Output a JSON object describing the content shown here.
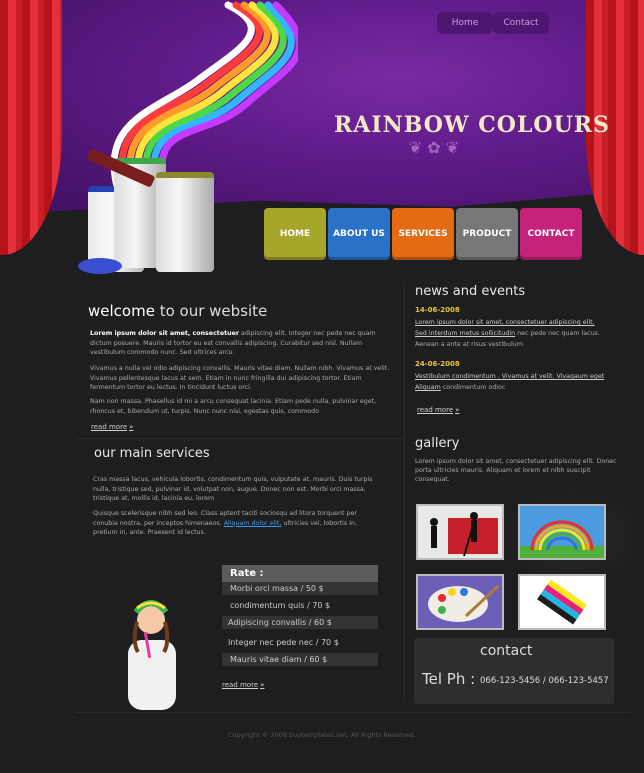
{
  "header": {
    "top_links": [
      "Home",
      "Contact"
    ],
    "brand": "RAINBOW COLOURS",
    "colors": {
      "purple": "#5c1a86",
      "curtain": "#d2232c"
    }
  },
  "nav": {
    "items": [
      {
        "label": "HOME",
        "color": "#a6a62a"
      },
      {
        "label": "ABOUT US",
        "color": "#2a72c8"
      },
      {
        "label": "SERVICES",
        "color": "#e46a14"
      },
      {
        "label": "PRODUCT",
        "color": "#777777"
      },
      {
        "label": "CONTACT",
        "color": "#c5237a"
      }
    ]
  },
  "welcome": {
    "title_strong": "welcome",
    "title_rest": " to our website",
    "p1_bold": "Lorem ipsum dolor sit amet, consectetuer",
    "p1_rest": " adipiscing elit. Integer nec pede nec quam dictum posuere. Mauris id tortor eu est convallis adipiscing. Curabitur sed nisl. Nullam vestibulum commodo nunc. Sed ultrices arcu.",
    "p2": "Vivamus a nulla vel odio adipiscing convallis. Mauris vitae diam. Nullam nibh. Vivamus at velit. Vivamus pellentesque lacus at sem. Etiam in nunc fringilla dui adipiscing tortor. Etiam fermentum tortor eu lectus. In tincidunt luctus orci.",
    "p3": "Nam non massa. Phasellus id mi a arcu consequat lacinia. Etiam pede nulla, pulvinar eget, rhoncus et, bibendum ut, turpis. Nunc nunc nisi, egestas quis, commodo",
    "read_more": "read more"
  },
  "services": {
    "title": "our main services",
    "p1": "Cras massa lacus, vehicula lobortis, condimentum quis, vulputate at, mauris. Duis turpis nulla, tristique sed, pulvinar id, volutpat non, augue. Donec non est. Morbi orci massa, tristique at, mollis id, lacinia eu, lorem",
    "p2_start": "Quisque scelerisque nibh sed leo. Class aptent taciti sociosqu ad litora torquent per conubia nostra, per inceptos himenaeos. ",
    "p2_link": "Aliquam dolor elit,",
    "p2_end": " ultricies vel, lobortis in, pretium in, ante. Praesent id lectus.",
    "read_more": "read more"
  },
  "rate": {
    "title": "Rate :",
    "rows": [
      {
        "label": "Morbi orci massa",
        "price": "50 $"
      },
      {
        "label": "condimentum quis",
        "price": "70 $"
      },
      {
        "label": "Adipiscing convallis",
        "price": "60  $"
      },
      {
        "label": "Integer nec pede nec",
        "price": "70 $"
      },
      {
        "label": "Mauris vitae diam",
        "price": "60  $"
      }
    ]
  },
  "news": {
    "title": "news and events",
    "items": [
      {
        "date": "14-06-2008",
        "link1": "Lorem ipsum dolor sit amet, consectetuer adipiscing elit.",
        "link2": "Sed interdum metus sollicitudin",
        "text2": " nec pede nec quam lacus.",
        "text3": "Aenean a ante at risus vestibulum"
      },
      {
        "date": "24-06-2008",
        "link1": "Vestibulum condimentum . Vivamus at velit. Vivagaum eget",
        "link2": "Aliquam",
        "text2": " condimentum odioc"
      }
    ],
    "read_more": "read more"
  },
  "gallery": {
    "title": "gallery",
    "text": "Lorem ipsum dolor sit amet, consectetuer adipiscing elit. Donec porta ultricies mauris. Aliquam et lorem et nibh suscipit consequat."
  },
  "contact": {
    "title": "contact",
    "tel_label": "Tel Ph :",
    "tel_numbers": "066-123-5456  /  066-123-5457"
  },
  "footer": {
    "copyright": "Copyright © 2008 buytemplates.net. All Rights Reserved."
  }
}
